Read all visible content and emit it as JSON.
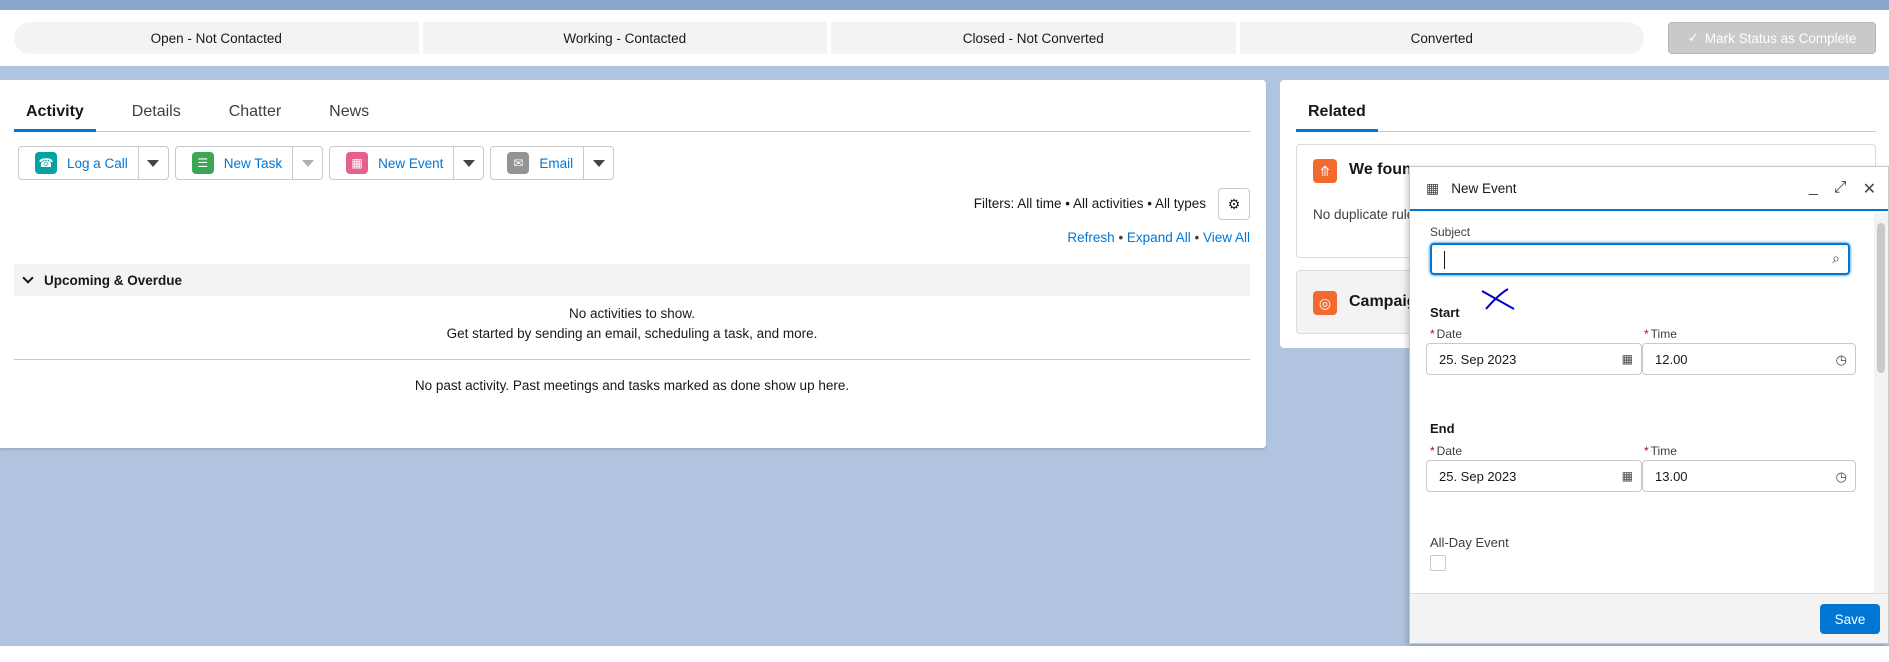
{
  "path": {
    "stages": [
      "Open - Not Contacted",
      "Working - Contacted",
      "Closed - Not Converted",
      "Converted"
    ],
    "mark_label": "Mark Status as Complete"
  },
  "activity": {
    "tabs": [
      "Activity",
      "Details",
      "Chatter",
      "News"
    ],
    "actions": {
      "log_call": "Log a Call",
      "new_task": "New Task",
      "new_event": "New Event",
      "email": "Email"
    },
    "filters": "Filters: All time • All activities • All types",
    "links": {
      "refresh": "Refresh",
      "expand_all": "Expand All",
      "view_all": "View All"
    },
    "upcoming_title": "Upcoming & Overdue",
    "no_activities_1": "No activities to show.",
    "no_activities_2": "Get started by sending an email, scheduling a task, and more.",
    "no_past": "No past activity. Past meetings and tasks marked as done show up here."
  },
  "related": {
    "tab": "Related",
    "duplicate_title": "We foun",
    "duplicate_text": "No duplicate rule",
    "campaign_title": "Campaig"
  },
  "new_event": {
    "title": "New Event",
    "subject_label": "Subject",
    "subject_value": "",
    "start_label": "Start",
    "end_label": "End",
    "date_label": "Date",
    "time_label": "Time",
    "start_date": "25. Sep 2023",
    "start_time": "12.00",
    "end_date": "25. Sep 2023",
    "end_time": "13.00",
    "all_day_label": "All-Day Event",
    "save_label": "Save"
  }
}
